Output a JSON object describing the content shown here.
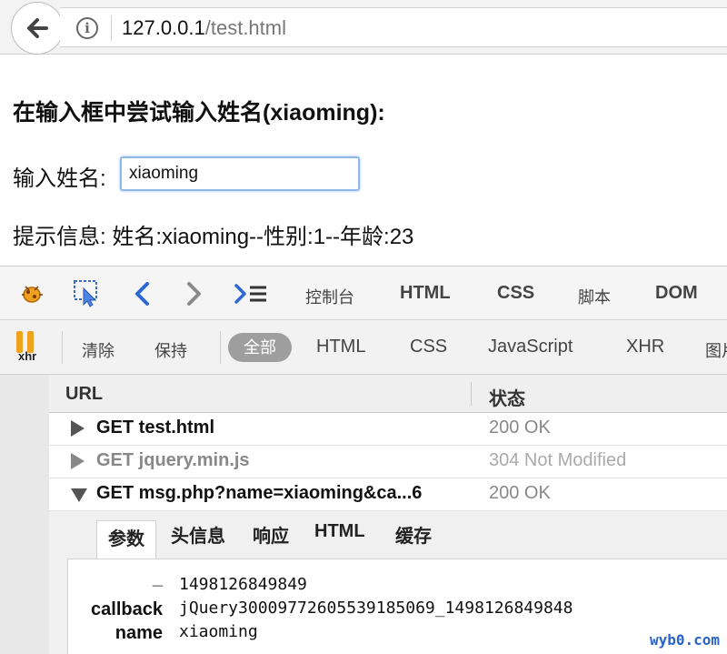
{
  "browser": {
    "url_host": "127.0.0.1",
    "url_path": "/test.html"
  },
  "page": {
    "heading": "在输入框中尝试输入姓名(xiaoming):",
    "input_label": "输入姓名:",
    "input_value": "xiaoming",
    "message": "提示信息: 姓名:xiaoming--性别:1--年龄:23"
  },
  "firebug": {
    "tabs": [
      "控制台",
      "HTML",
      "CSS",
      "脚本",
      "DOM"
    ],
    "net_toolbar": {
      "xhr_label": "xhr",
      "clear": "清除",
      "persist": "保持",
      "filters": [
        "全部",
        "HTML",
        "CSS",
        "JavaScript",
        "XHR",
        "图片"
      ],
      "active_filter": "全部"
    },
    "columns": {
      "url": "URL",
      "status": "状态"
    },
    "requests": [
      {
        "url": "GET test.html",
        "status": "200 OK",
        "expanded": false,
        "dim": false
      },
      {
        "url": "GET jquery.min.js",
        "status": "304 Not Modified",
        "expanded": false,
        "dim": true
      },
      {
        "url": "GET msg.php?name=xiaoming&ca...6",
        "status": "200 OK",
        "expanded": true,
        "dim": false
      }
    ],
    "detail_tabs": [
      "参数",
      "头信息",
      "响应",
      "HTML",
      "缓存"
    ],
    "active_detail_tab": "参数",
    "params": [
      {
        "key": "_",
        "value": "1498126849849"
      },
      {
        "key": "callback",
        "value": "jQuery30009772605539185069_1498126849848"
      },
      {
        "key": "name",
        "value": "xiaoming"
      }
    ]
  },
  "watermark": "wyb0.com"
}
